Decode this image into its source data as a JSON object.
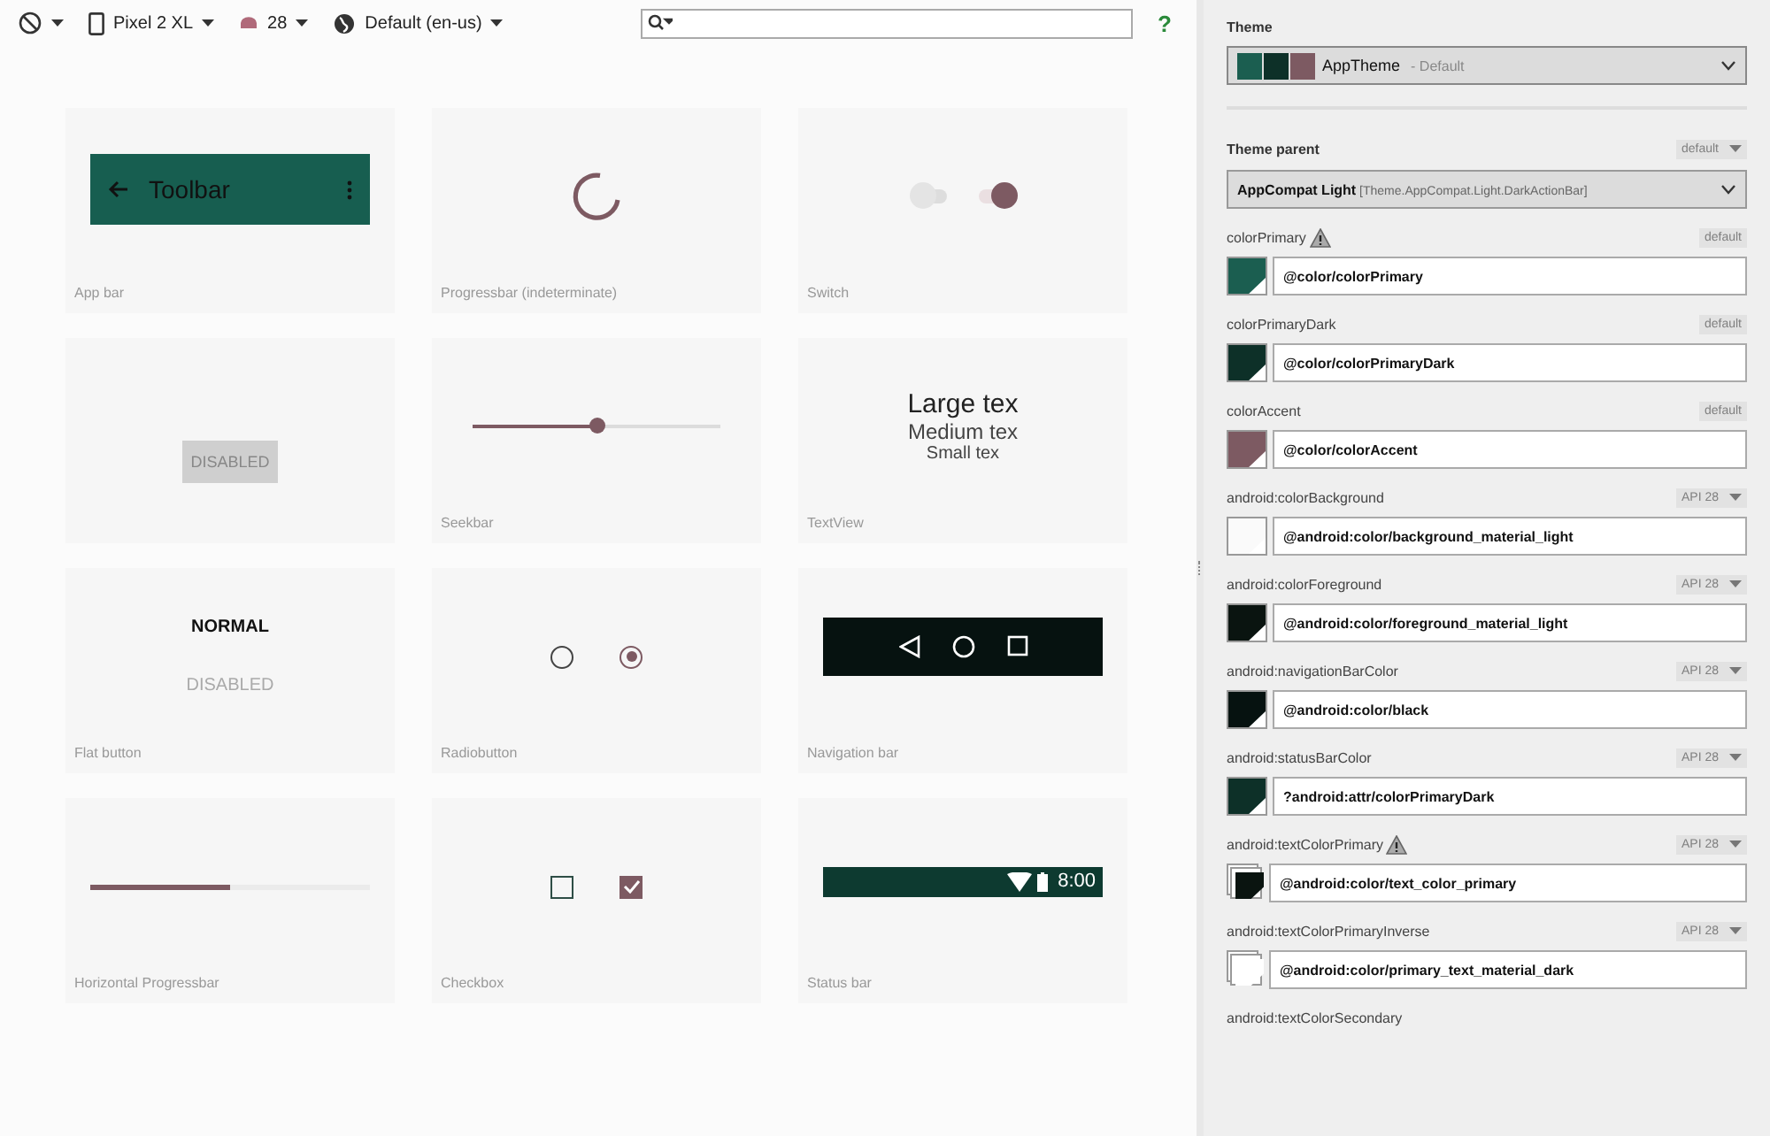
{
  "toolbar": {
    "device": "Pixel 2 XL",
    "api": "28",
    "locale": "Default (en-us)",
    "help": "?"
  },
  "previews": [
    {
      "kind": "appbar",
      "label": "App bar",
      "title": "Toolbar"
    },
    {
      "kind": "spinner",
      "label": "Progressbar (indeterminate)"
    },
    {
      "kind": "switch",
      "label": "Switch",
      "switches": [
        {
          "on": false
        },
        {
          "on": true
        }
      ]
    },
    {
      "kind": "button",
      "text": "DISABLED"
    },
    {
      "kind": "seekbar",
      "label": "Seekbar",
      "level": 0.5
    },
    {
      "kind": "textview",
      "label": "TextView",
      "texts": [
        "Large tex",
        "Medium tex",
        "Small tex"
      ]
    },
    {
      "kind": "flat",
      "label": "Flat button",
      "buttons": [
        {
          "text": "NORMAL",
          "disabled": false
        },
        {
          "text": "DISABLED",
          "disabled": true
        }
      ]
    },
    {
      "kind": "radio",
      "label": "Radiobutton",
      "radios": [
        {
          "selected": false
        },
        {
          "selected": true
        }
      ]
    },
    {
      "kind": "navbar",
      "label": "Navigation bar"
    },
    {
      "kind": "progress",
      "label": "Horizontal Progressbar",
      "level": 0.5
    },
    {
      "kind": "checkbox",
      "label": "Checkbox",
      "boxes": [
        {
          "checked": false
        },
        {
          "checked": true
        }
      ]
    },
    {
      "kind": "statusbar",
      "label": "Status bar",
      "time": "8:00"
    }
  ],
  "theme": {
    "label": "Theme",
    "name": "AppTheme",
    "suffix": "- Default",
    "swatches": [
      {
        "color": "#1b5e50"
      },
      {
        "color": "#0d3028"
      },
      {
        "color": "#7d5a62"
      }
    ]
  },
  "theme_parent": {
    "label": "Theme parent",
    "tag": "default",
    "value": "**AppCompat Light** [Theme.AppCompat.Light.DarkActionBar]"
  },
  "attributes": [
    {
      "name": "colorPrimary",
      "warning": true,
      "tag": "default",
      "dropdown": false,
      "value": "@color/colorPrimary",
      "color": "#1b5e50",
      "stacked": false
    },
    {
      "name": "colorPrimaryDark",
      "warning": false,
      "tag": "default",
      "dropdown": false,
      "value": "@color/colorPrimaryDark",
      "color": "#0d3028",
      "stacked": false
    },
    {
      "name": "colorAccent",
      "warning": false,
      "tag": "default",
      "dropdown": false,
      "value": "@color/colorAccent",
      "color": "#7d5a62",
      "stacked": false
    },
    {
      "name": "android:colorBackground",
      "warning": false,
      "tag": "API 28",
      "dropdown": true,
      "value": "@android:color/background_material_light",
      "color": "#fafafa",
      "stacked": false
    },
    {
      "name": "android:colorForeground",
      "warning": false,
      "tag": "API 28",
      "dropdown": true,
      "value": "@android:color/foreground_material_light",
      "color": "#0a1410",
      "stacked": false
    },
    {
      "name": "android:navigationBarColor",
      "warning": false,
      "tag": "API 28",
      "dropdown": true,
      "value": "@android:color/black",
      "color": "#061210",
      "stacked": false
    },
    {
      "name": "android:statusBarColor",
      "warning": false,
      "tag": "API 28",
      "dropdown": true,
      "value": "?android:attr/colorPrimaryDark",
      "color": "#0d3028",
      "stacked": false
    },
    {
      "name": "android:textColorPrimary",
      "warning": true,
      "tag": "API 28",
      "dropdown": true,
      "value": "@android:color/text_color_primary",
      "color": "#0a1410",
      "stacked": true
    },
    {
      "name": "android:textColorPrimaryInverse",
      "warning": false,
      "tag": "API 28",
      "dropdown": true,
      "value": "@android:color/primary_text_material_dark",
      "color": "#ffffff",
      "stacked": true
    },
    {
      "name": "android:textColorSecondary",
      "warning": false
    }
  ]
}
